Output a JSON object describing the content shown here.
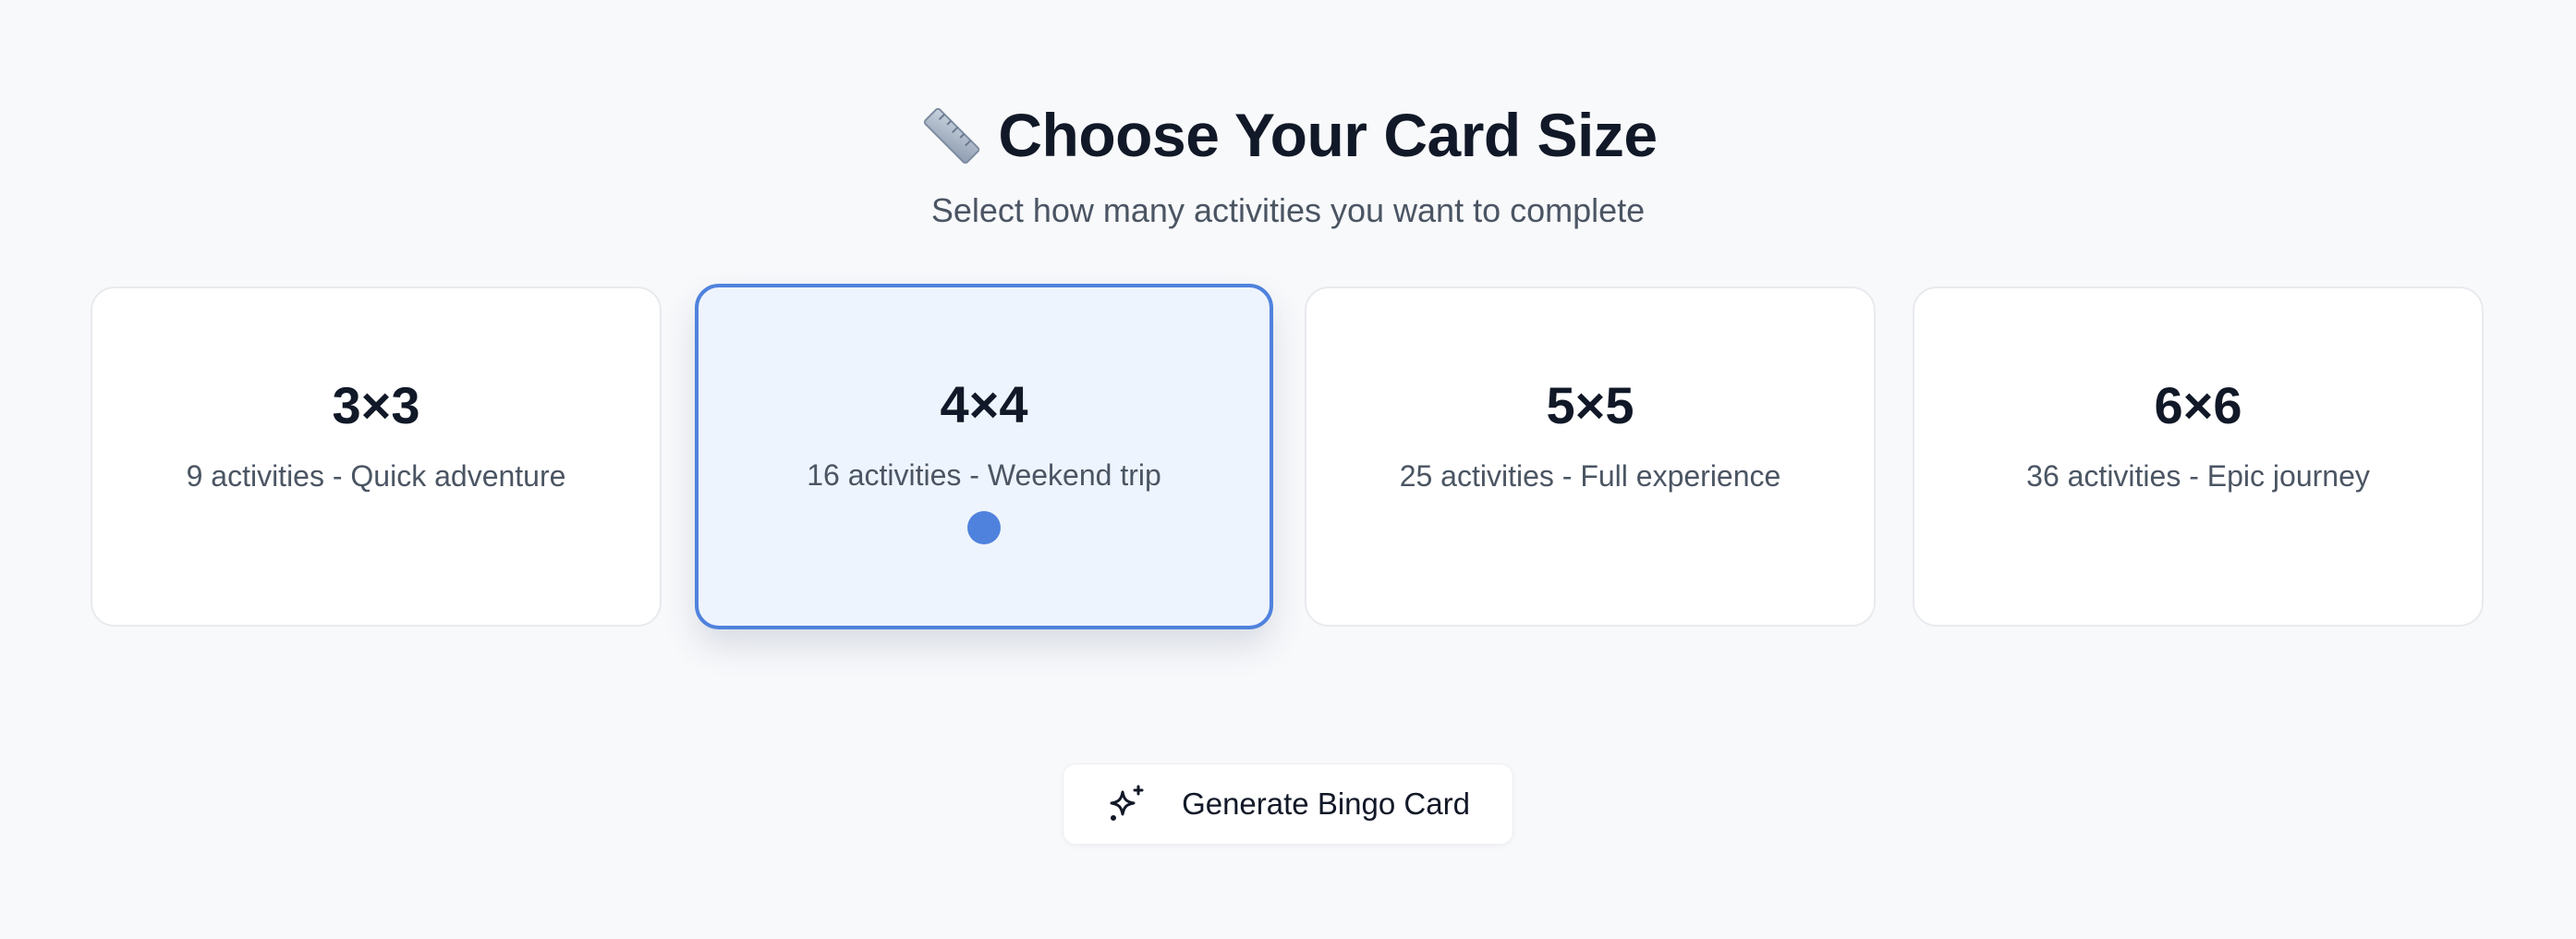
{
  "header": {
    "icon": "ruler-icon",
    "title": "Choose Your Card Size",
    "subtitle": "Select how many activities you want to complete"
  },
  "cards": [
    {
      "size": "3×3",
      "description": "9 activities - Quick adventure",
      "selected": false
    },
    {
      "size": "4×4",
      "description": "16 activities - Weekend trip",
      "selected": true
    },
    {
      "size": "5×5",
      "description": "25 activities - Full experience",
      "selected": false
    },
    {
      "size": "6×6",
      "description": "36 activities - Epic journey",
      "selected": false
    }
  ],
  "generate_button": {
    "icon": "sparkles-icon",
    "label": "Generate Bingo Card"
  },
  "colors": {
    "accent": "#4f82dd",
    "selected_background": "#eef4fd",
    "page_background": "#f8f9fb",
    "heading_text": "#111827",
    "muted_text": "#4b5563"
  }
}
